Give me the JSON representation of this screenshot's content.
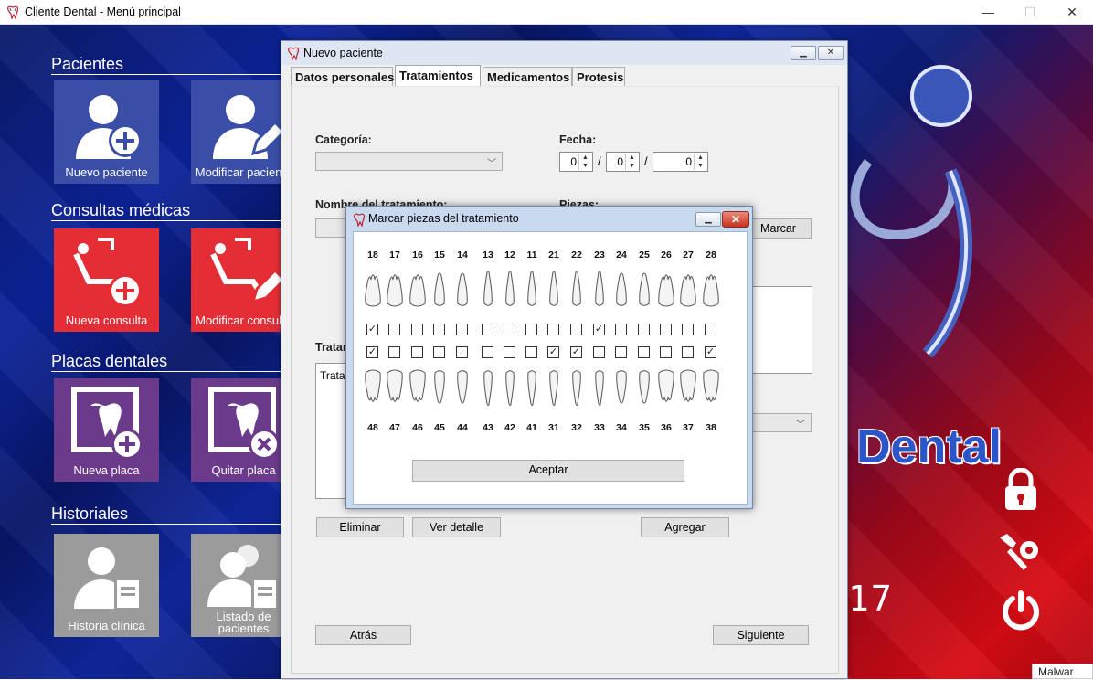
{
  "window": {
    "title": "Cliente Dental - Menú principal",
    "min": "—",
    "max": "☐",
    "close": "✕"
  },
  "menu": {
    "sections": [
      {
        "title": "Pacientes",
        "tiles": [
          "Nuevo paciente",
          "Modificar paciente"
        ]
      },
      {
        "title": "Consultas médicas",
        "tiles": [
          "Nueva consulta",
          "Modificar consulta"
        ]
      },
      {
        "title": "Placas dentales",
        "tiles": [
          "Nueva placa",
          "Quitar placa"
        ]
      },
      {
        "title": "Historiales",
        "tiles": [
          "Historia clínica",
          "Listado de pacientes"
        ]
      }
    ],
    "brand": "Dental",
    "clock": "17"
  },
  "taskbar": {
    "malware_label": "Malwar"
  },
  "dialog": {
    "title": "Nuevo paciente",
    "tabs": [
      "Datos personales",
      "Tratamientos",
      "Medicamentos",
      "Protesis"
    ],
    "active_tab": "Tratamientos",
    "categoria_label": "Categoría:",
    "categoria_value": "",
    "fecha_label": "Fecha:",
    "fecha": {
      "day": "0",
      "month": "0",
      "year": "0",
      "sep": "/"
    },
    "nombre_label": "Nombre del tratamiento:",
    "piezas_label": "Piezas:",
    "marcar_button": "Marcar",
    "tratamientos_label": "Tratamientos:",
    "list_header": "Tratamiento",
    "eliminar_button": "Eliminar",
    "ver_detalle_button": "Ver detalle",
    "agregar_button": "Agregar",
    "atras_button": "Atrás",
    "siguiente_button": "Siguiente"
  },
  "teeth_dialog": {
    "title": "Marcar piezas del tratamiento",
    "upper_numbers": [
      "18",
      "17",
      "16",
      "15",
      "14",
      "13",
      "12",
      "11",
      "21",
      "22",
      "23",
      "24",
      "25",
      "26",
      "27",
      "28"
    ],
    "lower_numbers": [
      "48",
      "47",
      "46",
      "45",
      "44",
      "43",
      "42",
      "41",
      "31",
      "32",
      "33",
      "34",
      "35",
      "36",
      "37",
      "38"
    ],
    "upper_checked": [
      true,
      false,
      false,
      false,
      false,
      false,
      false,
      false,
      false,
      false,
      true,
      false,
      false,
      false,
      false,
      false
    ],
    "lower_checked": [
      true,
      false,
      false,
      false,
      false,
      false,
      false,
      false,
      true,
      true,
      false,
      false,
      false,
      false,
      false,
      true
    ],
    "accept_button": "Aceptar"
  }
}
